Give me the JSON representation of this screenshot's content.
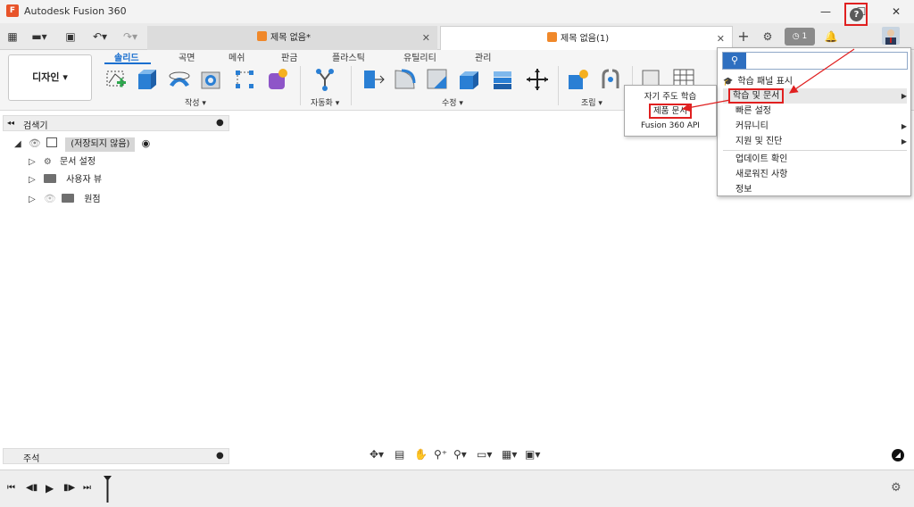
{
  "window": {
    "title": "Autodesk Fusion 360",
    "logo_letter": "F",
    "minimize": "—",
    "maximize": "☐",
    "close": "✕"
  },
  "quick_access": {
    "grid": "▦",
    "file": "▬▾",
    "save": "▣",
    "undo": "↶▾",
    "redo": "↷▾"
  },
  "tabs": [
    {
      "label": "제목 없음*",
      "close": "✕"
    },
    {
      "label": "제목 없음(1)",
      "close": "✕"
    }
  ],
  "header_right": {
    "new_tab": "+",
    "online": "⚙",
    "job_status": "◷ 1",
    "notifications": "🔔",
    "help": "?"
  },
  "workspace": {
    "label": "디자인 ▾"
  },
  "toolbar_tabs": [
    "솔리드",
    "곡면",
    "메쉬",
    "판금",
    "플라스틱",
    "유틸리티",
    "관리"
  ],
  "tool_groups": {
    "create": "작성 ▾",
    "automate": "자동화 ▾",
    "modify": "수정 ▾",
    "assemble": "조립 ▾"
  },
  "browser": {
    "title": "검색기",
    "collapse": "◂◂",
    "options": "●",
    "root": "(저장되지 않음)",
    "items": [
      "문서 설정",
      "사용자 뷰",
      "원점"
    ]
  },
  "comments": {
    "title": "주석",
    "add": "●"
  },
  "help_menu": {
    "search_icon": "⚲",
    "search_value": "",
    "items": [
      {
        "label": "학습 패널 표시",
        "arrow": ""
      },
      {
        "label": "학습 및 문서",
        "arrow": "▶"
      },
      {
        "label": "빠른 설정",
        "arrow": ""
      },
      {
        "label": "커뮤니티",
        "arrow": "▶"
      },
      {
        "label": "지원 및 진단",
        "arrow": "▶"
      },
      {
        "label": "업데이트 확인",
        "arrow": ""
      },
      {
        "label": "새로워진 사항",
        "arrow": ""
      },
      {
        "label": "정보",
        "arrow": ""
      }
    ]
  },
  "submenu": {
    "items": [
      "자기 주도 학습",
      "제품 문서",
      "Fusion 360 API"
    ]
  },
  "colors": {
    "accent": "#1a6fcf",
    "highlight_red": "#e02020",
    "tab_orange": "#f0882a"
  }
}
